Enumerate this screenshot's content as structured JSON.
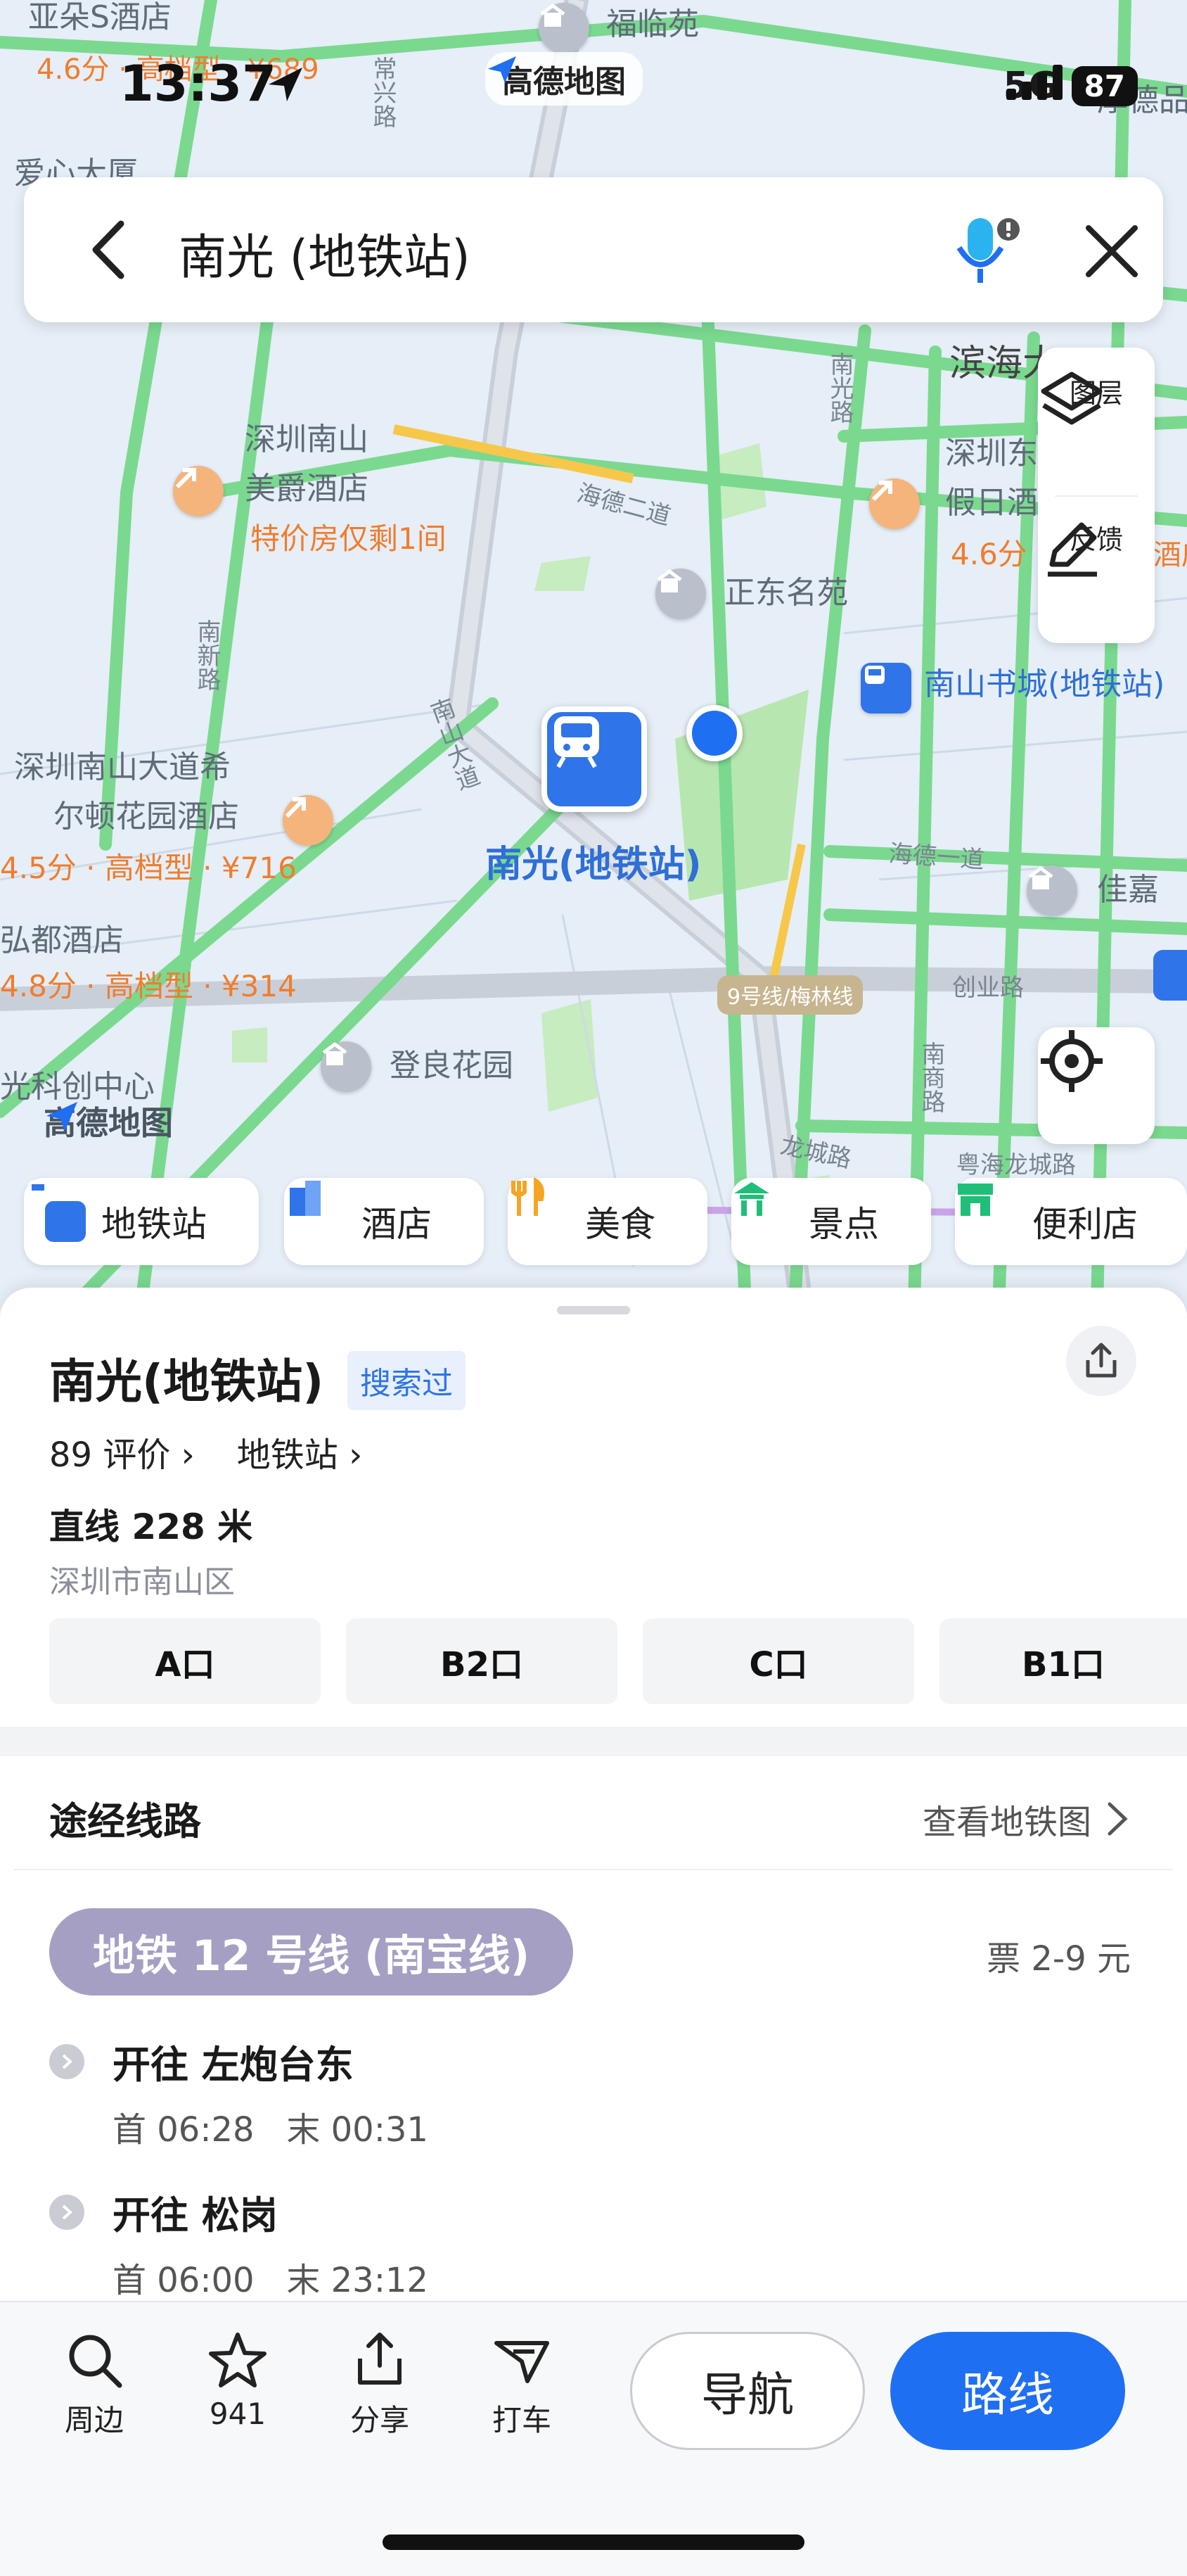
{
  "status_bar": {
    "time": "13:37",
    "network": "5G",
    "battery": "87",
    "app_tag": "高德地图"
  },
  "search": {
    "query": "南光 (地铁站)"
  },
  "tools": {
    "layers": "图层",
    "feedback": "反馈"
  },
  "map": {
    "labels": {
      "hotel1": "亚朵S酒店",
      "hotel1_price": "4.6分 · 高档型 · ¥689",
      "fulinyuan": "福临苑",
      "houdepin": "厚德品",
      "aixin": "爱心大厦",
      "changxing": "常兴路",
      "binhai": "滨海大",
      "nanshan_meijue_1": "深圳南山",
      "nanshan_meijue_2": "美爵酒店",
      "nanshan_meijue_promo": "特价房仅剩1间",
      "haide2": "海德二道",
      "zhengdong": "正东名苑",
      "nanguang_road": "南光路",
      "jiari1": "深圳东",
      "jiari2": "假日酒",
      "jiari_score": "4.6分",
      "jiudian_r": "酒店",
      "nanshan_bookcity": "南山书城(地铁站)",
      "nanxin": "南新路",
      "nanshan_ave": "南山大道",
      "hilton1": "深圳南山大道希",
      "hilton2": "尔顿花园酒店",
      "hilton_price": "4.5分 · 高档型 · ¥716",
      "station_name": "南光(地铁站)",
      "haide1": "海德一道",
      "jiajia": "佳嘉",
      "hongdu": "弘都酒店",
      "hongdu_price": "4.8分 · 高档型 · ¥314",
      "line9": "9号线/梅林线",
      "chuangye": "创业路",
      "dengliang": "登良花园",
      "guangke": "光科创中心",
      "nanshang": "南商路",
      "longcheng": "龙城路",
      "yuehai_longcheng": "粤海龙城路",
      "watermark": "高德地图"
    }
  },
  "categories": [
    {
      "label": "地铁站",
      "color": "#2f74e8"
    },
    {
      "label": "酒店",
      "color": "#2f74e8"
    },
    {
      "label": "美食",
      "color": "#f5a524"
    },
    {
      "label": "景点",
      "color": "#1fbf7a"
    },
    {
      "label": "便利店",
      "color": "#1fbf7a"
    }
  ],
  "place": {
    "name": "南光(地铁站)",
    "badge": "搜索过",
    "reviews": "89 评价",
    "type": "地铁站",
    "distance": "直线 228 米",
    "district": "深圳市南山区",
    "exits": [
      "A口",
      "B2口",
      "C口",
      "B1口"
    ]
  },
  "routes": {
    "title": "途经线路",
    "metro_map_link": "查看地铁图",
    "line": {
      "name": "地铁 12 号线 (南宝线)",
      "color": "#a59fc3",
      "fare": "票 2-9 元"
    },
    "directions": [
      {
        "title": "开往 左炮台东",
        "first": "首 06:28",
        "last": "末 00:31"
      },
      {
        "title": "开往 松岗",
        "first": "首 06:00",
        "last": "末 23:12"
      }
    ]
  },
  "actions": {
    "nearby": "周边",
    "favorites": "941",
    "share": "分享",
    "taxi": "打车",
    "navigate": "导航",
    "route": "路线"
  },
  "colors": {
    "accent": "#1f6ff2",
    "road_green": "#7ad98f",
    "map_bg": "#e6eef7",
    "park": "#b8e6b0"
  }
}
